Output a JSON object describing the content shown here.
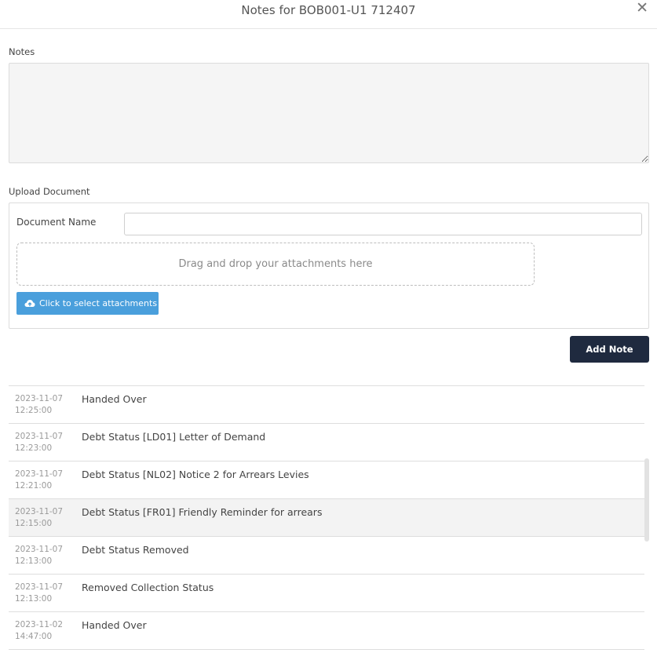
{
  "modal": {
    "title": "Notes for BOB001-U1 712407",
    "close_icon": "close-icon",
    "close_glyph": "✕"
  },
  "notes_section": {
    "label": "Notes",
    "value": "",
    "placeholder": ""
  },
  "upload": {
    "label": "Upload Document",
    "doc_name_label": "Document Name",
    "doc_name_value": "",
    "dropzone_text": "Drag and drop your attachments here",
    "select_button_label": "Click to select attachments",
    "select_button_color": "#4a9fdc"
  },
  "add_note_button": {
    "label": "Add Note",
    "color": "#1f2a3f"
  },
  "notes": [
    {
      "date": "2023-11-07",
      "time": "12:25:00",
      "text": "Handed Over"
    },
    {
      "date": "2023-11-07",
      "time": "12:23:00",
      "text": "Debt Status [LD01] Letter of Demand"
    },
    {
      "date": "2023-11-07",
      "time": "12:21:00",
      "text": "Debt Status [NL02] Notice 2 for Arrears Levies"
    },
    {
      "date": "2023-11-07",
      "time": "12:15:00",
      "text": "Debt Status [FR01] Friendly Reminder for arrears"
    },
    {
      "date": "2023-11-07",
      "time": "12:13:00",
      "text": "Debt Status Removed"
    },
    {
      "date": "2023-11-07",
      "time": "12:13:00",
      "text": "Removed Collection Status"
    },
    {
      "date": "2023-11-02",
      "time": "14:47:00",
      "text": "Handed Over"
    }
  ]
}
